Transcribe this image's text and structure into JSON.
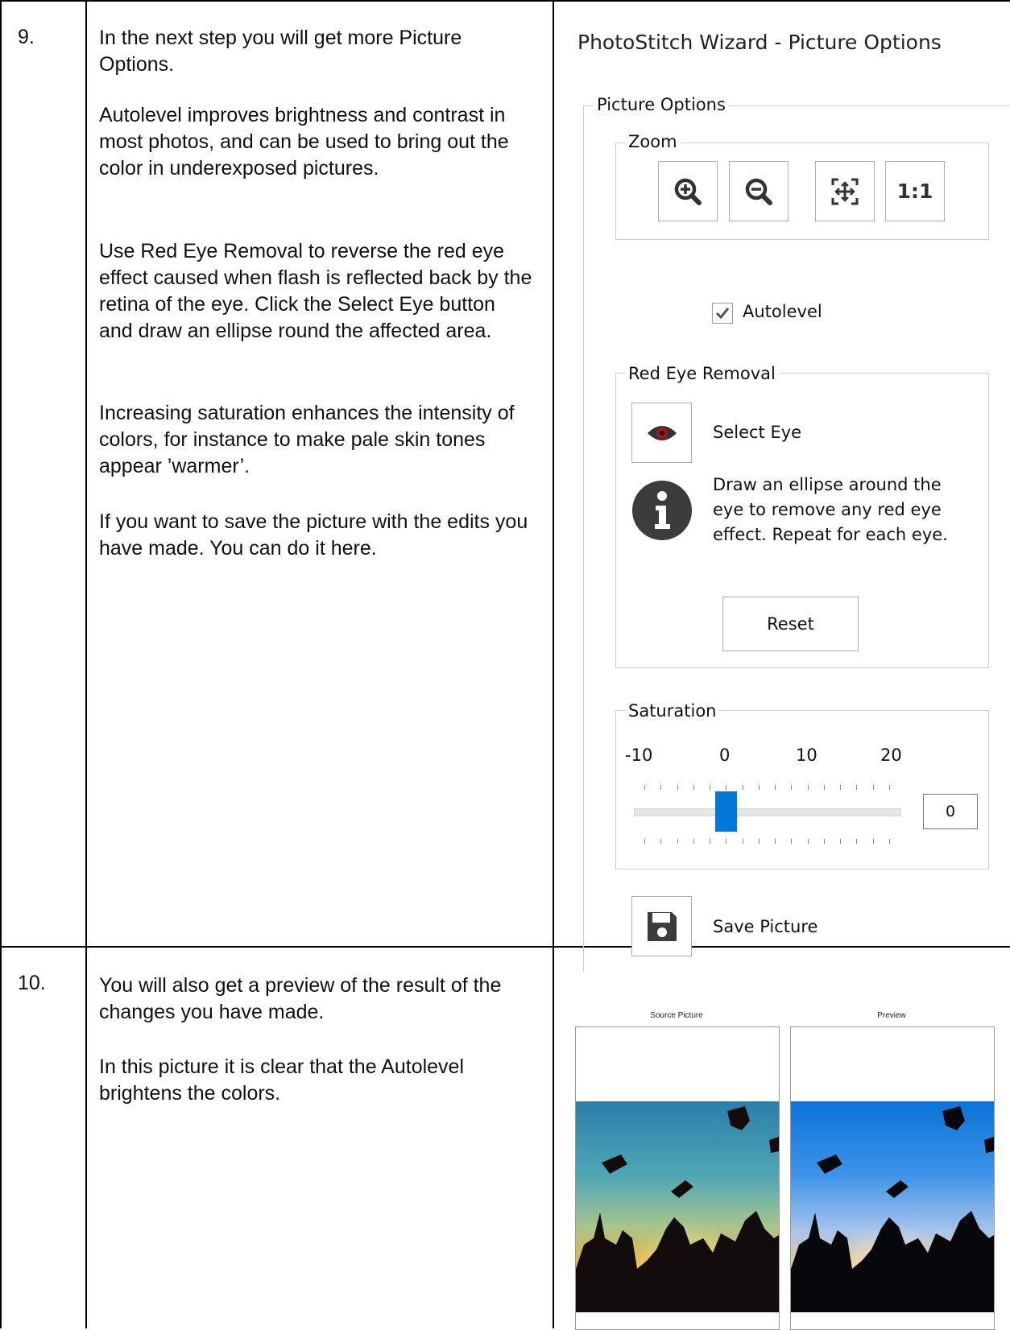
{
  "rows": [
    {
      "number": "9.",
      "paragraphs": [
        "In the next step you will get more Picture Options.",
        "Autolevel improves brightness and contrast in most photos, and can be used to bring out the color in underexposed pictures.",
        "Use Red Eye Removal to reverse the red eye effect caused when flash is reflected back by the retina of the eye. Click the Select Eye button and draw an ellipse round the affected area.",
        "Increasing saturation enhances the intensity of colors, for instance to make pale skin tones appear ’warmer’.",
        "If you want to save the picture with the edits you have made. You can do it here."
      ]
    },
    {
      "number": "10.",
      "paragraphs": [
        "You will also get a preview of the result of the changes you have made.",
        "In this picture it is clear that the Autolevel brightens the colors."
      ]
    }
  ],
  "wizard": {
    "title": "PhotoStitch Wizard - Picture Options",
    "group_label": "Picture Options",
    "zoom": {
      "label": "Zoom",
      "buttons": [
        {
          "icon": "zoom-in-icon"
        },
        {
          "icon": "zoom-out-icon"
        },
        {
          "icon": "fit-to-window-icon"
        },
        {
          "icon": "actual-size-icon",
          "label": "1:1"
        }
      ]
    },
    "autolevel": {
      "label": "Autolevel",
      "checked": true
    },
    "red_eye": {
      "label": "Red Eye Removal",
      "select_eye_label": "Select Eye",
      "info_text": [
        "Draw an ellipse around the",
        "eye to remove any red eye",
        "effect. Repeat for each eye."
      ],
      "reset_label": "Reset"
    },
    "saturation": {
      "label": "Saturation",
      "scale_labels": [
        "-10",
        "0",
        "10",
        "20"
      ],
      "value": "0",
      "slider_value": 0,
      "min": -10,
      "max": 20
    },
    "save_label": "Save Picture",
    "accent_color": "#0078d7"
  },
  "preview": {
    "source_label": "Source Picture",
    "preview_label": "Preview"
  }
}
